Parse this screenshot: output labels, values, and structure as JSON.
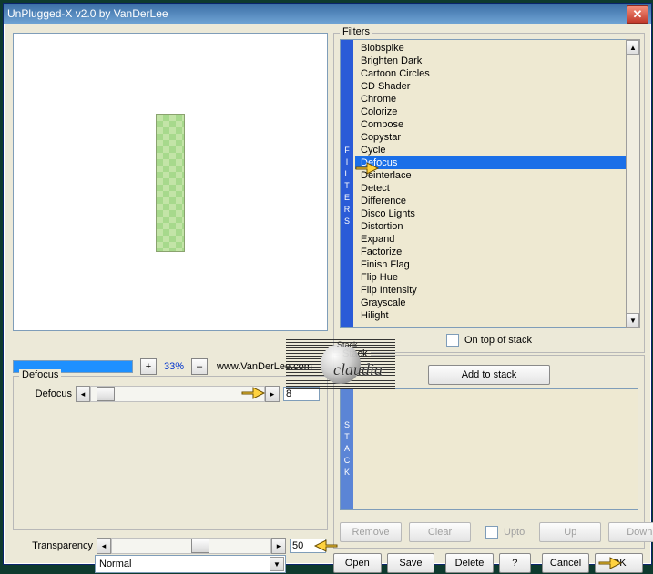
{
  "window": {
    "title": "UnPlugged-X v2.0 by VanDerLee"
  },
  "zoom": {
    "plus": "+",
    "value": "33%",
    "minus": "–",
    "url": "www.VanDerLee.com"
  },
  "defocus_group": {
    "label": "Defocus",
    "slider_label": "Defocus",
    "value": "8"
  },
  "transparency": {
    "label": "Transparency",
    "value": "50"
  },
  "blend": {
    "mode": "Normal"
  },
  "filters": {
    "group_label": "Filters",
    "tab": "FILTERS",
    "items": [
      "Blobspike",
      "Brighten Dark",
      "Cartoon Circles",
      "CD Shader",
      "Chrome",
      "Colorize",
      "Compose",
      "Copystar",
      "Cycle",
      "Defocus",
      "Deinterlace",
      "Detect",
      "Difference",
      "Disco Lights",
      "Distortion",
      "Expand",
      "Factorize",
      "Finish Flag",
      "Flip Hue",
      "Flip Intensity",
      "Grayscale",
      "Hilight"
    ],
    "selected_index": 9,
    "on_top": "On top of stack"
  },
  "stack": {
    "group_label": "Stack",
    "tab": "STACK",
    "add": "Add to stack",
    "remove": "Remove",
    "clear": "Clear",
    "upto": "Upto",
    "up": "Up",
    "down": "Down"
  },
  "bottom": {
    "open": "Open",
    "save": "Save",
    "delete": "Delete",
    "help": "?",
    "cancel": "Cancel",
    "ok": "OK"
  },
  "watermark": {
    "top": "Stack",
    "name": "claudia"
  }
}
